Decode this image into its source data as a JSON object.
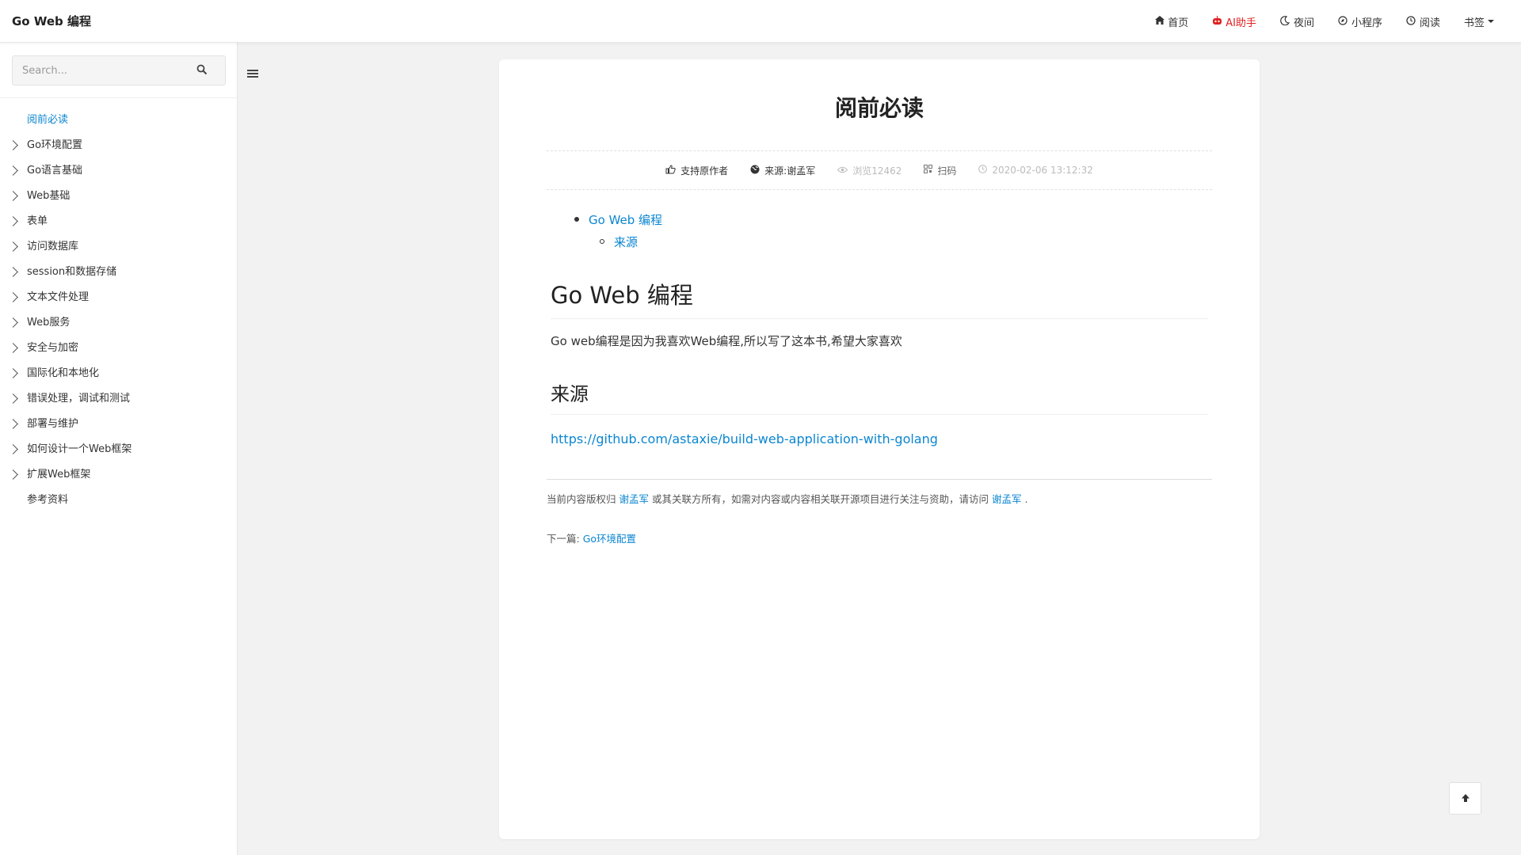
{
  "navbar": {
    "brand": "Go Web 编程",
    "items": [
      {
        "label": "首页",
        "icon": "home-icon"
      },
      {
        "label": "AI助手",
        "icon": "robot-icon",
        "color": "#e02020"
      },
      {
        "label": "夜间",
        "icon": "moon-icon"
      },
      {
        "label": "小程序",
        "icon": "compass-icon"
      },
      {
        "label": "阅读",
        "icon": "clock-icon"
      },
      {
        "label": "书签",
        "icon": "caret-down-icon"
      }
    ]
  },
  "sidebar": {
    "search_placeholder": "Search...",
    "items": [
      {
        "label": "阅前必读",
        "active": true,
        "expandable": false
      },
      {
        "label": "Go环境配置",
        "expandable": true
      },
      {
        "label": "Go语言基础",
        "expandable": true
      },
      {
        "label": "Web基础",
        "expandable": true
      },
      {
        "label": "表单",
        "expandable": true
      },
      {
        "label": "访问数据库",
        "expandable": true
      },
      {
        "label": "session和数据存储",
        "expandable": true
      },
      {
        "label": "文本文件处理",
        "expandable": true
      },
      {
        "label": "Web服务",
        "expandable": true
      },
      {
        "label": "安全与加密",
        "expandable": true
      },
      {
        "label": "国际化和本地化",
        "expandable": true
      },
      {
        "label": "错误处理，调试和测试",
        "expandable": true
      },
      {
        "label": "部署与维护",
        "expandable": true
      },
      {
        "label": "如何设计一个Web框架",
        "expandable": true
      },
      {
        "label": "扩展Web框架",
        "expandable": true
      },
      {
        "label": "参考资料",
        "expandable": false
      }
    ]
  },
  "article": {
    "title": "阅前必读",
    "meta": {
      "support": "支持原作者",
      "source": "来源:谢孟军",
      "views": "浏览12462",
      "scan": "扫码",
      "date": "2020-02-06 13:12:32"
    },
    "toc": {
      "level1": "Go Web 编程",
      "level2": "来源"
    },
    "heading1": "Go Web 编程",
    "paragraph": "Go web编程是因为我喜欢Web编程,所以写了这本书,希望大家喜欢",
    "heading2": "来源",
    "url": "https://github.com/astaxie/build-web-application-with-golang",
    "copyright": {
      "prefix": "当前内容版权归",
      "owner": "谢孟军",
      "middle": "或其关联方所有，如需对内容或内容相关联开源项目进行关注与资助，请访问",
      "owner2": "谢孟军",
      "suffix": "."
    },
    "next": {
      "label": "下一篇:",
      "link": "Go环境配置"
    }
  },
  "colors": {
    "link": "#0b86d1",
    "ai": "#e02020",
    "background": "#f2f2f2"
  }
}
